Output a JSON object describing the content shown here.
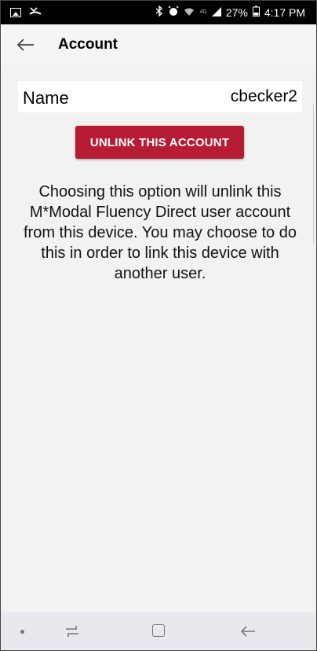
{
  "status_bar": {
    "battery_percent": "27%",
    "time": "4:17 PM",
    "network": "4G"
  },
  "app_bar": {
    "title": "Account"
  },
  "account": {
    "name_label": "Name",
    "name_value": "cbecker2"
  },
  "actions": {
    "unlink_label": "UNLINK THIS ACCOUNT"
  },
  "description": "Choosing this option will unlink this M*Modal Fluency Direct user account from this device. You may choose to do this in order to link this device with another user.",
  "colors": {
    "accent": "#b71c35",
    "status_bar": "#000000",
    "background": "#f2f2f2"
  }
}
